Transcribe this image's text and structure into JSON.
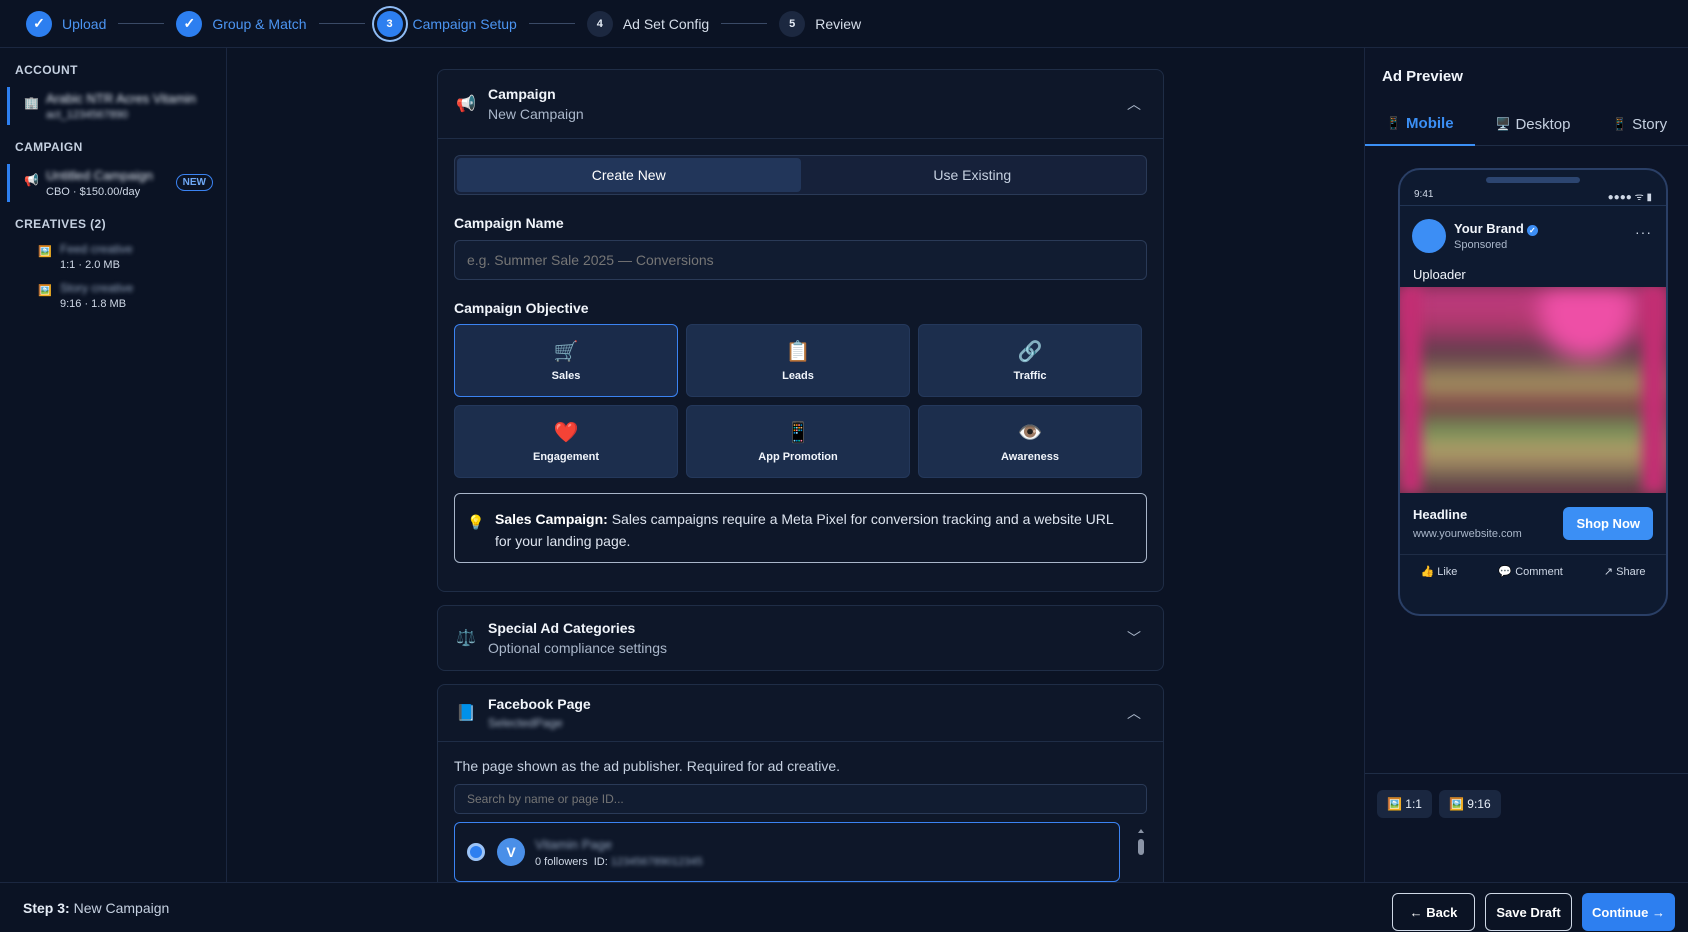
{
  "stepper": {
    "steps": [
      {
        "label": "Upload",
        "mark": "✓",
        "state": "done"
      },
      {
        "label": "Group & Match",
        "mark": "✓",
        "state": "done"
      },
      {
        "label": "Campaign Setup",
        "mark": "3",
        "state": "active"
      },
      {
        "label": "Ad Set Config",
        "mark": "4",
        "state": "pending"
      },
      {
        "label": "Review",
        "mark": "5",
        "state": "pending"
      }
    ]
  },
  "sidebar": {
    "account_heading": "ACCOUNT",
    "account": {
      "name": "Arabic NTR Acres Vitamin",
      "id": "act_1234567890"
    },
    "campaign_heading": "CAMPAIGN",
    "campaign": {
      "name": "Untitled Campaign",
      "meta": "CBO · $150.00/day",
      "badge": "NEW"
    },
    "creatives_heading": "CREATIVES (2)",
    "creatives": [
      {
        "name": "Feed creative",
        "meta": "1:1 · 2.0 MB"
      },
      {
        "name": "Story creative",
        "meta": "9:16 · 1.8 MB"
      }
    ]
  },
  "campaign_panel": {
    "title": "Campaign",
    "subtitle": "New Campaign",
    "toggle": {
      "create": "Create New",
      "existing": "Use Existing"
    },
    "name_label": "Campaign Name",
    "name_placeholder": "e.g. Summer Sale 2025 — Conversions",
    "objective_label": "Campaign Objective",
    "objectives": [
      {
        "label": "Sales",
        "icon": "🛒",
        "selected": true
      },
      {
        "label": "Leads",
        "icon": "📋",
        "selected": false
      },
      {
        "label": "Traffic",
        "icon": "🔗",
        "selected": false
      },
      {
        "label": "Engagement",
        "icon": "❤️",
        "selected": false
      },
      {
        "label": "App Promotion",
        "icon": "📱",
        "selected": false
      },
      {
        "label": "Awareness",
        "icon": "👁️",
        "selected": false
      }
    ],
    "hint": {
      "bold": "Sales Campaign:",
      "text": " Sales campaigns require a Meta Pixel for conversion tracking and a website URL for your landing page."
    }
  },
  "special_panel": {
    "title": "Special Ad Categories",
    "subtitle": "Optional compliance settings"
  },
  "fb_panel": {
    "title": "Facebook Page",
    "subtitle": "SelectedPage",
    "desc": "The page shown as the ad publisher. Required for ad creative.",
    "search_placeholder": "Search by name or page ID...",
    "page": {
      "initial": "V",
      "name": "Vitamin Page",
      "followers": "0 followers",
      "id_label": "ID:",
      "id_value": "123456789012345"
    }
  },
  "preview": {
    "title": "Ad Preview",
    "tabs": [
      "Mobile",
      "Desktop",
      "Story"
    ],
    "time": "9:41",
    "status_icons": "●●●● ᯤ ▮",
    "brand": "Your Brand",
    "sponsored": "Sponsored",
    "post_text": "Uploader",
    "headline": "Headline",
    "url": "www.yourwebsite.com",
    "cta": "Shop Now",
    "actions": [
      "Like",
      "Comment",
      "Share"
    ],
    "ratios": [
      "1:1",
      "9:16"
    ]
  },
  "footer": {
    "step_bold": "Step 3:",
    "step_text": " New Campaign",
    "back": "← Back",
    "save": "Save Draft",
    "continue": "Continue →"
  },
  "colors": {
    "accent": "#2d7ff0",
    "background": "#0b1324",
    "panel": "#0e1729"
  }
}
